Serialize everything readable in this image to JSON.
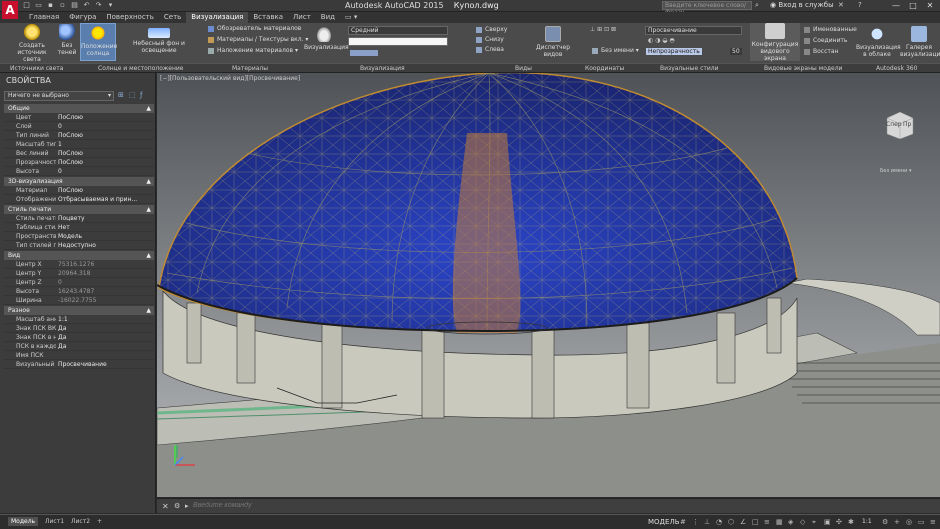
{
  "app": {
    "title": "Autodesk AutoCAD 2015",
    "file": "Купол.dwg",
    "search_placeholder": "Введите ключевое слово/фразу",
    "signin": "Вход в службы",
    "logo": "A",
    "help_icon": "?"
  },
  "tabs": [
    "Главная",
    "Фигура",
    "Поверхность",
    "Сеть",
    "Визуализация",
    "Вставка",
    "Лист",
    "Вид"
  ],
  "active_tab": "Визуализация",
  "ribbon": {
    "create_light": "Создать источник света",
    "no_shadows": "Без теней",
    "sun_position": "Положение солнца",
    "sky_background": "Небесный фон и освещение",
    "materials_browser": "Обозреватель материалов",
    "materials_textures": "Материалы / Текстуры вкл.",
    "apply_materials": "Наложение материалов",
    "render": "Визуализация",
    "render_quality": "Средний",
    "view_top": "Сверху",
    "view_bottom": "Снизу",
    "view_left": "Слева",
    "view_manager": "Диспетчер видов",
    "unnamed": "Без имени",
    "visual_style": "Просвечивание",
    "opacity_label": "Непрозрачность",
    "opacity_value": "50",
    "viewport_config": "Конфигурация видового экрана",
    "named": "Именованные",
    "join": "Соединить",
    "restore": "Восстан",
    "render_cloud": "Визуализация в облаке",
    "render_gallery": "Галерея визуализации"
  },
  "panels": [
    "Источники света",
    "Солнце и местоположение",
    "Материалы",
    "Визуализация",
    "Виды",
    "Координаты",
    "Визуальные стили",
    "Видовые экраны модели",
    "Autodesk 360"
  ],
  "properties": {
    "title": "СВОЙСТВА",
    "selection": "Ничего не выбрано",
    "sections": [
      {
        "name": "Общие",
        "rows": [
          {
            "k": "Цвет",
            "v": "ПоСлою"
          },
          {
            "k": "Слой",
            "v": "0"
          },
          {
            "k": "Тип линий",
            "v": "ПоСлою"
          },
          {
            "k": "Масштаб типа л...",
            "v": "1"
          },
          {
            "k": "Вес линий",
            "v": "ПоСлою"
          },
          {
            "k": "Прозрачность",
            "v": "ПоСлою"
          },
          {
            "k": "Высота",
            "v": "0"
          }
        ]
      },
      {
        "name": "3D-визуализация",
        "rows": [
          {
            "k": "Материал",
            "v": "ПоСлою"
          },
          {
            "k": "Отображение т...",
            "v": "Отбрасываемая и прин..."
          }
        ]
      },
      {
        "name": "Стиль печати",
        "rows": [
          {
            "k": "Стиль печати",
            "v": "Поцвету"
          },
          {
            "k": "Таблица стилей...",
            "v": "Нет"
          },
          {
            "k": "Пространство т...",
            "v": "Модель"
          },
          {
            "k": "Тип стилей печ...",
            "v": "Недоступно"
          }
        ]
      },
      {
        "name": "Вид",
        "rows": [
          {
            "k": "Центр X",
            "v": "75316.1276"
          },
          {
            "k": "Центр Y",
            "v": "20964.318"
          },
          {
            "k": "Центр Z",
            "v": "0"
          },
          {
            "k": "Высота",
            "v": "16243.4787"
          },
          {
            "k": "Ширина",
            "v": "-16022.7755"
          }
        ]
      },
      {
        "name": "Разное",
        "rows": [
          {
            "k": "Масштаб аннот...",
            "v": "1:1"
          },
          {
            "k": "Знак ПСК ВКЛ",
            "v": "Да"
          },
          {
            "k": "Знак ПСК в нач...",
            "v": "Да"
          },
          {
            "k": "ПСК в каждом В...",
            "v": "Да"
          },
          {
            "k": "Имя ПСК",
            "v": ""
          },
          {
            "k": "Визуальный сти...",
            "v": "Просвечивание"
          }
        ]
      }
    ]
  },
  "viewport": {
    "label": "[−][Пользовательский вид][Просвечивание]",
    "cube_front": "Спер",
    "cube_right": "Пр",
    "wcs": "Без имени"
  },
  "command": {
    "placeholder": "Введите команду"
  },
  "status": {
    "tabs": [
      "Модель",
      "Лист1",
      "Лист2"
    ],
    "model": "МОДЕЛЬ",
    "scale": "1:1"
  },
  "colors": {
    "accent": "#5a7fae",
    "dome": "#2a3fc0",
    "logo": "#c8102e"
  }
}
